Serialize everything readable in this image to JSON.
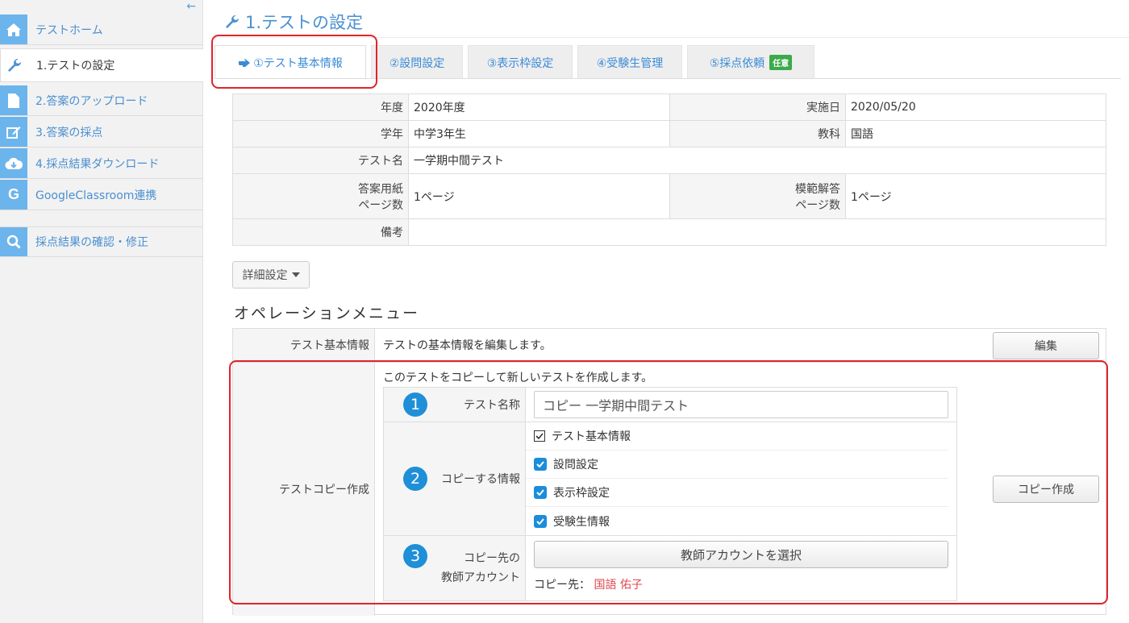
{
  "sidebar": {
    "items": [
      {
        "label": "テストホーム",
        "icon": "home-icon"
      },
      {
        "label": "1.テストの設定",
        "icon": "wrench-icon"
      },
      {
        "label": "2.答案のアップロード",
        "icon": "document-icon"
      },
      {
        "label": "3.答案の採点",
        "icon": "edit-icon"
      },
      {
        "label": "4.採点結果ダウンロード",
        "icon": "cloud-download-icon"
      },
      {
        "label": "GoogleClassroom連携",
        "icon": "google-icon"
      },
      {
        "label": "採点結果の確認・修正",
        "icon": "search-icon"
      }
    ],
    "collapse_icon": "←"
  },
  "page": {
    "title": "1.テストの設定"
  },
  "tabs": [
    {
      "label": "①テスト基本情報"
    },
    {
      "label": "②設問設定"
    },
    {
      "label": "③表示枠設定"
    },
    {
      "label": "④受験生管理"
    },
    {
      "label": "⑤採点依頼",
      "badge": "任意"
    }
  ],
  "info": {
    "year_label": "年度",
    "year_value": "2020年度",
    "date_label": "実施日",
    "date_value": "2020/05/20",
    "grade_label": "学年",
    "grade_value": "中学3年生",
    "subject_label": "教科",
    "subject_value": "国語",
    "testname_label": "テスト名",
    "testname_value": "一学期中間テスト",
    "answer_pages_label_1": "答案用紙",
    "answer_pages_label_2": "ページ数",
    "answer_pages_value": "1ページ",
    "model_pages_label_1": "模範解答",
    "model_pages_label_2": "ページ数",
    "model_pages_value": "1ページ",
    "note_label": "備考",
    "note_value": ""
  },
  "detail_button": "詳細設定",
  "operation": {
    "title": "オペレーションメニュー",
    "basic": {
      "label": "テスト基本情報",
      "desc": "テストの基本情報を編集します。",
      "button": "編集"
    },
    "copy": {
      "label": "テストコピー作成",
      "desc": "このテストをコピーして新しいテストを作成します。",
      "button": "コピー作成",
      "name_label": "テスト名称",
      "name_value": "コピー 一学期中間テスト",
      "info_label": "コピーする情報",
      "info_items": [
        "テスト基本情報",
        "設問設定",
        "表示枠設定",
        "受験生情報"
      ],
      "teacher_label_1": "コピー先の",
      "teacher_label_2": "教師アカウント",
      "select_button": "教師アカウントを選択",
      "dest_label": "コピー先：",
      "dest_value": "国語 佑子",
      "nums": [
        "1",
        "2",
        "3"
      ]
    }
  }
}
